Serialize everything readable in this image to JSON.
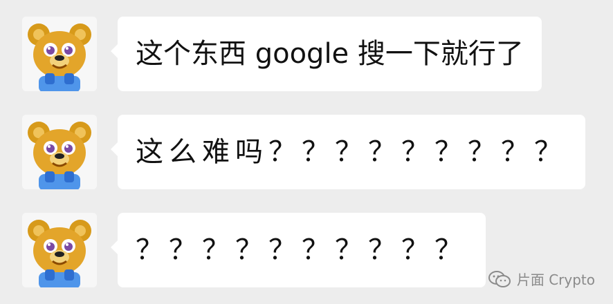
{
  "messages": [
    {
      "avatar_icon": "bear-avatar-icon",
      "text": "这个东西 google 搜一下就行了"
    },
    {
      "avatar_icon": "bear-avatar-icon",
      "text": "这么难吗？？？？？？？？？"
    },
    {
      "avatar_icon": "bear-avatar-icon",
      "text": "？？？？？？？？？？"
    }
  ],
  "watermark": {
    "icon": "wechat-icon",
    "label": "片面 Crypto"
  },
  "colors": {
    "background": "#ededed",
    "bubble": "#ffffff",
    "text": "#111111",
    "watermark": "#8a8a8a"
  }
}
